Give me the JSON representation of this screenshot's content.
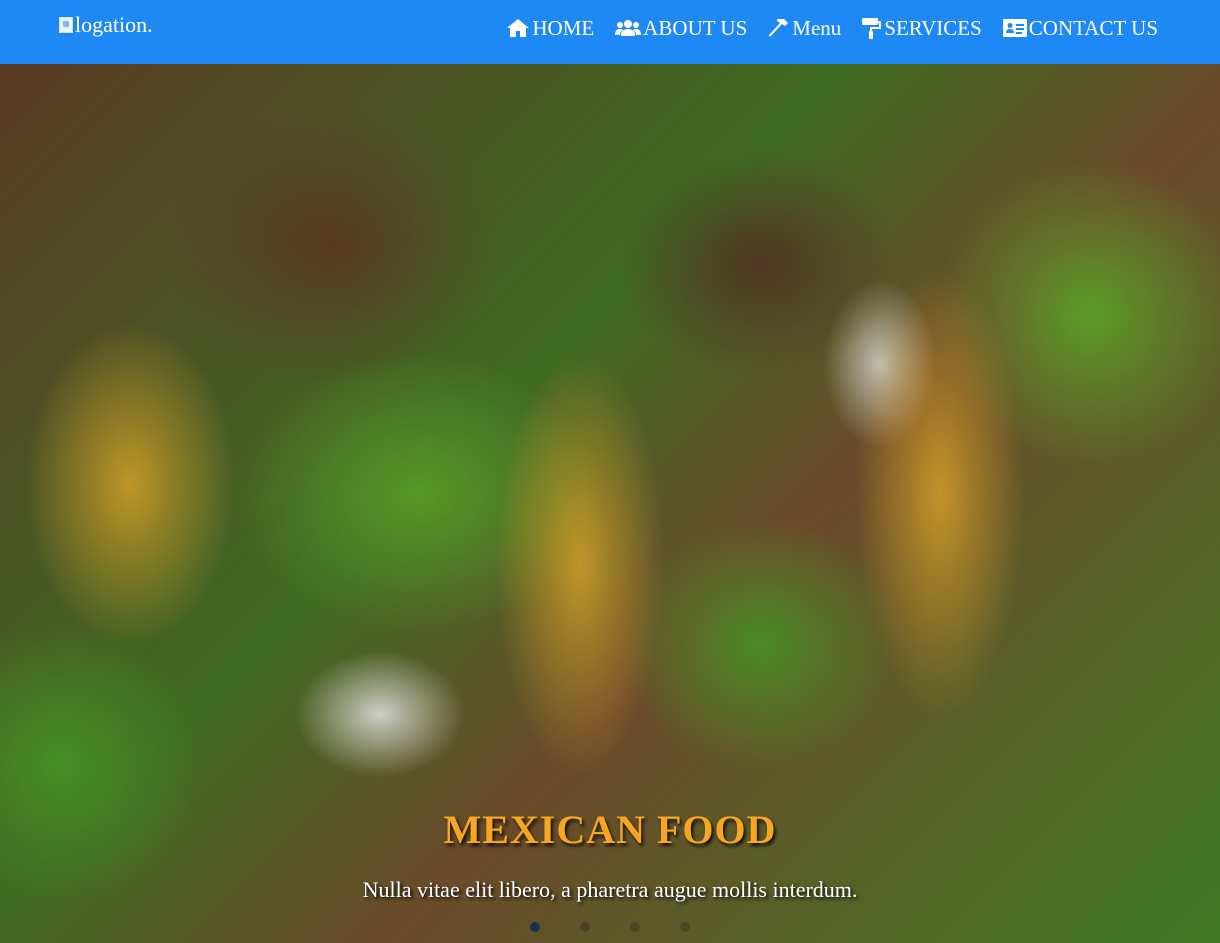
{
  "navbar": {
    "logo_alt": "logation.",
    "items": [
      {
        "label": "HOME",
        "icon": "home-icon"
      },
      {
        "label": "ABOUT US",
        "icon": "users-icon"
      },
      {
        "label": "Menu",
        "icon": "hammer-icon"
      },
      {
        "label": "SERVICES",
        "icon": "paint-roller-icon"
      },
      {
        "label": "CONTACT US",
        "icon": "address-card-icon"
      }
    ]
  },
  "carousel": {
    "title": "MEXICAN FOOD",
    "text": "Nulla vitae elit libero, a pharetra augue mollis interdum.",
    "slide_count": 4,
    "active_slide": 1
  },
  "colors": {
    "navbar": "#1e88f5",
    "title": "#f6a623"
  }
}
